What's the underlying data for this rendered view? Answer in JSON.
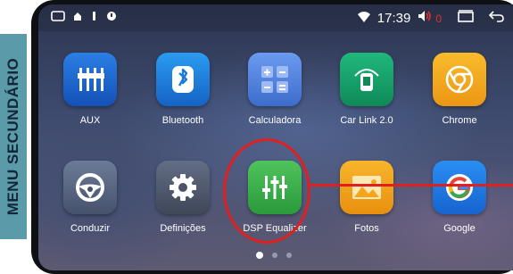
{
  "side_label": "MENU SECUNDÁRIO",
  "status_bar": {
    "left_icons": [
      "home-outline-icon",
      "android-icon",
      "cast-icon"
    ],
    "time": "17:39",
    "volume_level": "0",
    "right_icons": [
      "wifi-icon",
      "volume-icon",
      "recent-apps-icon",
      "back-icon"
    ]
  },
  "apps": [
    {
      "label": "AUX",
      "icon": "aux-sliders-icon",
      "color": "#1a63c8"
    },
    {
      "label": "Bluetooth",
      "icon": "bluetooth-icon",
      "color": "#1e7ad6"
    },
    {
      "label": "Calculadora",
      "icon": "calculator-icon",
      "color": "#4b7fd8"
    },
    {
      "label": "Car Link 2.0",
      "icon": "car-link-icon",
      "color": "#17a06b"
    },
    {
      "label": "Chrome",
      "icon": "chrome-icon",
      "color": "#f1a620"
    },
    {
      "label": "Conduzir",
      "icon": "steering-wheel-icon",
      "color": "#5a6984"
    },
    {
      "label": "Definições",
      "icon": "gear-icon",
      "color": "#505a70"
    },
    {
      "label": "DSP Equalizer",
      "icon": "equalizer-icon",
      "color": "#3bb04a"
    },
    {
      "label": "Fotos",
      "icon": "photos-icon",
      "color": "#f2a31a"
    },
    {
      "label": "Google",
      "icon": "google-icon",
      "color": "#1e78e0"
    }
  ],
  "pagination": {
    "pages": 3,
    "current": 1
  }
}
